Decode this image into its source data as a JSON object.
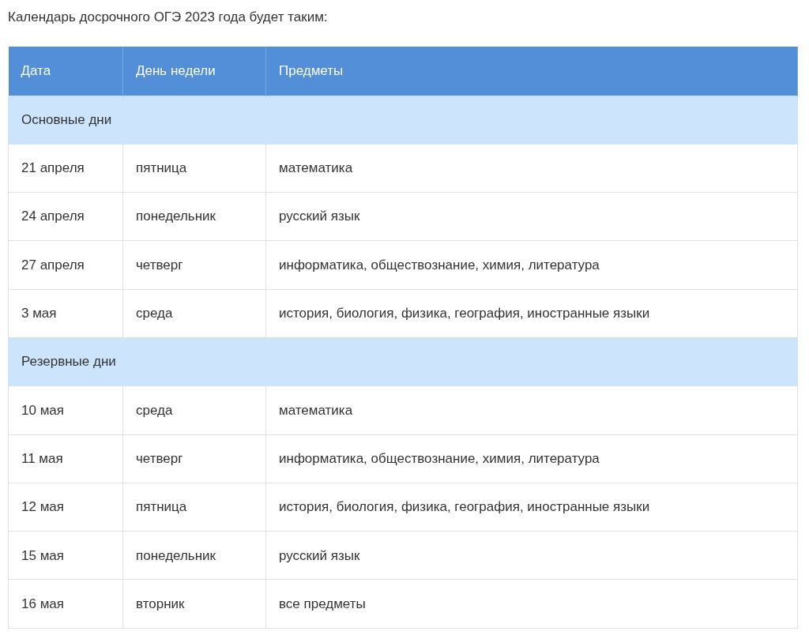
{
  "intro": "Календарь досрочного ОГЭ 2023 года будет таким:",
  "table": {
    "columns": [
      "Дата",
      "День недели",
      "Предметы"
    ],
    "sections": [
      {
        "title": "Основные дни",
        "rows": [
          [
            "21 апреля",
            "пятница",
            "математика"
          ],
          [
            "24 апреля",
            "понедельник",
            "русский язык"
          ],
          [
            "27 апреля",
            "четверг",
            "информатика, обществознание, химия, литература"
          ],
          [
            "3 мая",
            "среда",
            "история, биология, физика, география, иностранные языки"
          ]
        ]
      },
      {
        "title": "Резервные дни",
        "rows": [
          [
            "10 мая",
            "среда",
            "математика"
          ],
          [
            "11 мая",
            "четверг",
            "информатика, обществознание, химия, литература"
          ],
          [
            "12 мая",
            "пятница",
            "история, биология, физика, география, иностранные языки"
          ],
          [
            "15 мая",
            "понедельник",
            "русский язык"
          ],
          [
            "16 мая",
            "вторник",
            "все предметы"
          ]
        ]
      }
    ]
  }
}
